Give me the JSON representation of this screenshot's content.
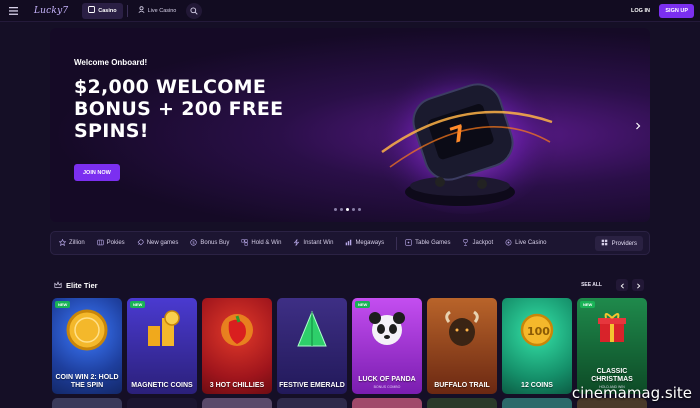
{
  "header": {
    "logo_text": "Lucky7",
    "tabs": [
      {
        "label": "Casino",
        "active": true
      },
      {
        "label": "Live Casino",
        "active": false
      }
    ],
    "login_label": "LOG IN",
    "signup_label": "SIGN UP"
  },
  "hero": {
    "eyebrow": "Welcome Onboard!",
    "title": "$2,000 WELCOME BONUS + 200 FREE SPINS!",
    "cta_label": "JOIN NOW",
    "slide_count": 5,
    "active_slide": 2
  },
  "categories": [
    {
      "label": "Zillion",
      "icon": "star-icon"
    },
    {
      "label": "Pokies",
      "icon": "slot-icon"
    },
    {
      "label": "New games",
      "icon": "rocket-icon"
    },
    {
      "label": "Bonus Buy",
      "icon": "coin-icon"
    },
    {
      "label": "Hold & Win",
      "icon": "hold-icon"
    },
    {
      "label": "Instant Win",
      "icon": "bolt-icon"
    },
    {
      "label": "Megaways",
      "icon": "megaways-icon"
    },
    {
      "label": "Table Games",
      "icon": "table-icon"
    },
    {
      "label": "Jackpot",
      "icon": "trophy-icon"
    },
    {
      "label": "Live Casino",
      "icon": "live-icon"
    }
  ],
  "providers_label": "Providers",
  "section": {
    "title": "Elite Tier",
    "see_all_label": "SEE ALL"
  },
  "games": [
    {
      "name": "COIN WIN 2: HOLD THE SPIN",
      "provider": "",
      "new": true,
      "color": "#1e4fb0"
    },
    {
      "name": "MAGNETIC COINS",
      "provider": "",
      "new": true,
      "color": "#3b2d9e"
    },
    {
      "name": "3 HOT CHILLIES",
      "provider": "",
      "new": false,
      "color": "#b41c24"
    },
    {
      "name": "FESTIVE EMERALD",
      "provider": "",
      "new": false,
      "color": "#3a2a70"
    },
    {
      "name": "LUCK OF PANDA",
      "provider": "",
      "new": true,
      "color": "#9b28c8",
      "subtitle": "BONUS COMBO"
    },
    {
      "name": "BUFFALO TRAIL",
      "provider": "",
      "new": false,
      "color": "#8e3a1c"
    },
    {
      "name": "12 COINS",
      "provider": "",
      "new": false,
      "color": "#1a9a74"
    },
    {
      "name": "CLASSIC CHRISTMAS",
      "provider": "",
      "new": true,
      "color": "#15663a",
      "subtitle": "HOLD AND WIN"
    }
  ],
  "watermark": "cinemamag.site"
}
